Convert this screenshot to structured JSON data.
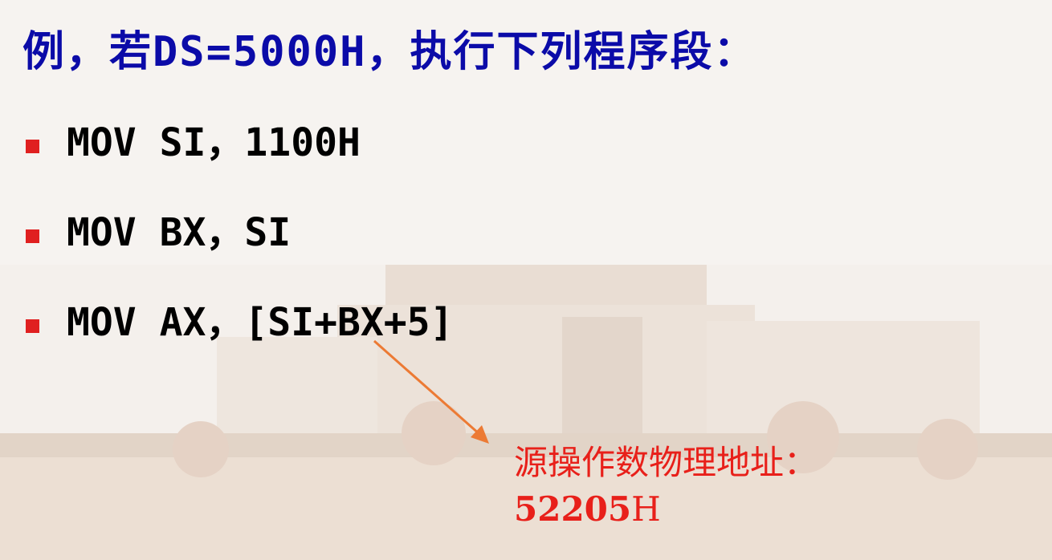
{
  "title": "例，若DS=5000H，执行下列程序段：",
  "code_lines": [
    "MOV SI，1100H",
    "MOV BX，SI",
    "MOV AX，[SI+BX+5]"
  ],
  "annotation": {
    "label": "源操作数物理地址：",
    "value_number": "52205",
    "value_suffix": "H"
  },
  "colors": {
    "title": "#0b0ba8",
    "bullet": "#e02020",
    "annotation": "#e8201a",
    "arrow": "#ec7a34"
  }
}
